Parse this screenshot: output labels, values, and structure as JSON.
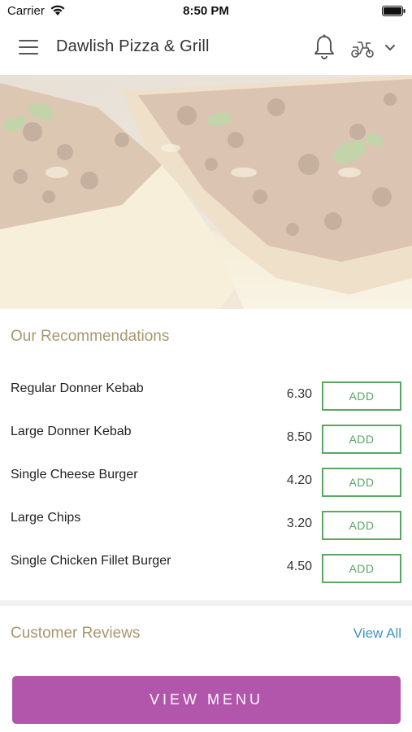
{
  "status_bar": {
    "carrier": "Carrier",
    "time": "8:50 PM"
  },
  "header": {
    "title": "Dawlish Pizza & Grill",
    "icons": [
      "menu-icon",
      "bell-icon",
      "scooter-icon",
      "chevron-down-icon"
    ]
  },
  "recommendations": {
    "title": "Our Recommendations",
    "add_label": "ADD",
    "items": [
      {
        "name": "Regular Donner Kebab",
        "price": "6.30"
      },
      {
        "name": "Large Donner Kebab",
        "price": "8.50"
      },
      {
        "name": "Single Cheese Burger",
        "price": "4.20"
      },
      {
        "name": "Large Chips",
        "price": "3.20"
      },
      {
        "name": "Single Chicken Fillet Burger",
        "price": "4.50"
      }
    ]
  },
  "reviews": {
    "title": "Customer Reviews",
    "view_all": "View All"
  },
  "footer": {
    "view_menu": "VIEW MENU"
  },
  "colors": {
    "accent_purple": "#b256ac",
    "add_green": "#5aa764",
    "section_title": "#a7986d",
    "link_blue": "#3e95c4"
  }
}
